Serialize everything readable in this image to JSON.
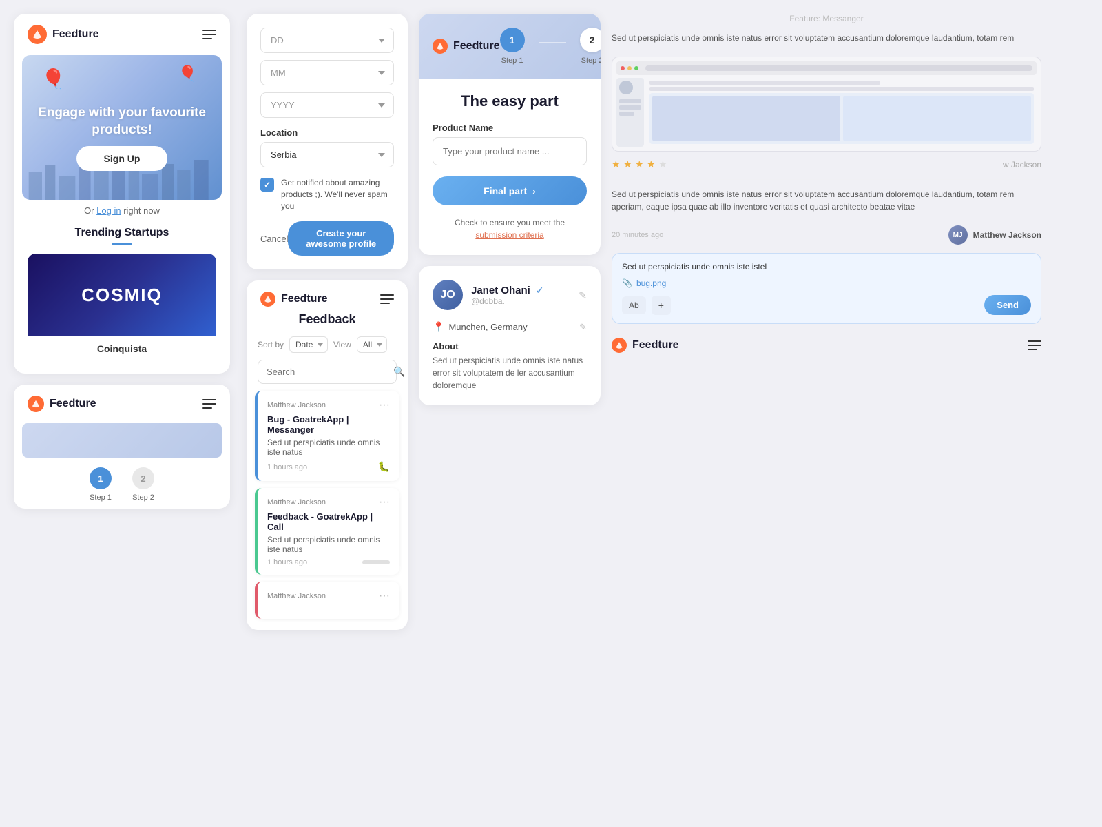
{
  "col1": {
    "logo": "Feedture",
    "hero_text": "Engage with your favourite products!",
    "signup_label": "Sign Up",
    "or_text": "Or",
    "login_text": "Log in",
    "right_now_text": "right now",
    "trending_title": "Trending Startups",
    "product_banner": "COSMIQ",
    "product_name": "Coinquista",
    "step1_label": "Step 1",
    "step2_label": "Step 2"
  },
  "col2": {
    "form": {
      "dd_placeholder": "DD",
      "mm_placeholder": "MM",
      "yyyy_placeholder": "YYYY",
      "location_label": "Location",
      "location_value": "Serbia",
      "checkbox_text": "Get notified about amazing products ;). We'll never spam you",
      "cancel_label": "Cancel",
      "create_label": "Create your awesome profile"
    },
    "feedback": {
      "title": "Feedback",
      "sort_label": "Sort by",
      "sort_value": "Date",
      "view_label": "View",
      "view_value": "All",
      "search_placeholder": "Search",
      "items": [
        {
          "author": "Matthew Jackson",
          "title": "Bug - GoatrekApp | Messanger",
          "body": "Sed ut perspiciatis unde omnis iste natus",
          "time": "1 hours ago",
          "type": "bug",
          "color": "blue"
        },
        {
          "author": "Matthew Jackson",
          "title": "Feedback - GoatrekApp | Call",
          "body": "Sed ut perspiciatis unde omnis iste natus",
          "time": "1 hours ago",
          "type": "feedback",
          "color": "green"
        },
        {
          "author": "Matthew Jackson",
          "title": "",
          "body": "",
          "time": "",
          "type": "feedback",
          "color": "red"
        }
      ]
    }
  },
  "col3": {
    "step_card": {
      "step1_num": "1",
      "step2_num": "2",
      "step1_label": "Step 1",
      "step2_label": "Step 2",
      "heading": "The easy part",
      "product_label": "Product Name",
      "product_placeholder": "Type your product name ...",
      "final_btn": "Final part",
      "submit_note": "Check to ensure you meet the",
      "submit_link": "submission criteria"
    },
    "profile": {
      "name": "Janet Ohani",
      "handle": "@dobba.",
      "location": "Munchen, Germany",
      "about_title": "About",
      "about_text": "Sed ut perspiciatis unde omnis iste natus error sit voluptatem de ler accusantium doloremque"
    }
  },
  "col4": {
    "feature_label": "Feature: Messanger",
    "review1_text": "Sed ut perspiciatis unde omnis iste natus error sit voluptatem accusantium doloremque laudantium, totam rem",
    "stars": 4,
    "reviewer": "w Jackson",
    "review2_text": "Sed ut perspiciatis unde omnis iste natus error sit voluptatem accusantium doloremque laudantium, totam rem aperiam, eaque ipsa quae ab illo inventore veritatis et quasi architecto beatae vitae",
    "review2_time": "20 minutes ago",
    "review2_author": "Matthew Jackson",
    "msg_input_text": "Sed ut perspiciatis unde omnis iste istel",
    "attachment": "bug.png",
    "format_btn": "Ab",
    "plus_btn": "+",
    "send_btn": "Send",
    "footer_logo": "Feedture"
  }
}
